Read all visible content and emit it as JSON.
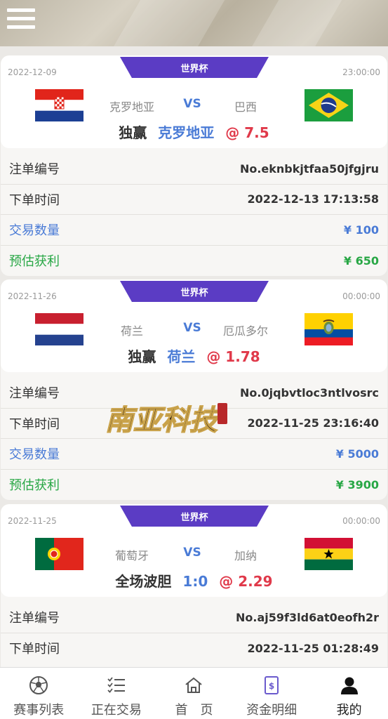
{
  "header": {
    "menu_icon": "menu-icon"
  },
  "labels": {
    "order_no": "注单编号",
    "order_time": "下单时间",
    "quantity": "交易数量",
    "profit": "预估获利"
  },
  "orders": [
    {
      "league": "世界杯",
      "date": "2022-12-09",
      "time": "23:00:00",
      "home": "克罗地亚",
      "vs": "VS",
      "away": "巴西",
      "home_flag": "croatia-flag",
      "away_flag": "brazil-flag",
      "bet_type": "独赢",
      "bet_pick": "克罗地亚",
      "bet_odds": "@ 7.5",
      "order_no": "No.eknbkjtfaa50jfgjru",
      "order_time": "2022-12-13 17:13:58",
      "quantity": "¥ 100",
      "profit": "¥ 650"
    },
    {
      "league": "世界杯",
      "date": "2022-11-26",
      "time": "00:00:00",
      "home": "荷兰",
      "vs": "VS",
      "away": "厄瓜多尔",
      "home_flag": "netherlands-flag",
      "away_flag": "ecuador-flag",
      "bet_type": "独赢",
      "bet_pick": "荷兰",
      "bet_odds": "@ 1.78",
      "order_no": "No.0jqbvtloc3ntlvosrc",
      "order_time": "2022-11-25 23:16:40",
      "quantity": "¥ 5000",
      "profit": "¥ 3900"
    },
    {
      "league": "世界杯",
      "date": "2022-11-25",
      "time": "00:00:00",
      "home": "葡萄牙",
      "vs": "VS",
      "away": "加纳",
      "home_flag": "portugal-flag",
      "away_flag": "ghana-flag",
      "bet_type": "全场波胆",
      "bet_pick": "1:0",
      "bet_odds": "@ 2.29",
      "order_no": "No.aj59f3ld6at0eofh2r",
      "order_time": "2022-11-25 01:28:49"
    }
  ],
  "watermark": {
    "text": "南亚科技"
  },
  "tabs": [
    {
      "label": "赛事列表",
      "icon": "soccer-ball-icon"
    },
    {
      "label": "正在交易",
      "icon": "checklist-icon"
    },
    {
      "label": "首　页",
      "icon": "home-icon"
    },
    {
      "label": "资金明细",
      "icon": "money-document-icon"
    },
    {
      "label": "我的",
      "icon": "user-icon",
      "active": true
    }
  ],
  "colors": {
    "league_tag": "#5b3cc4",
    "vs_blue": "#4a7bd6",
    "odds_red": "#e0394a",
    "profit_green": "#28a745"
  }
}
